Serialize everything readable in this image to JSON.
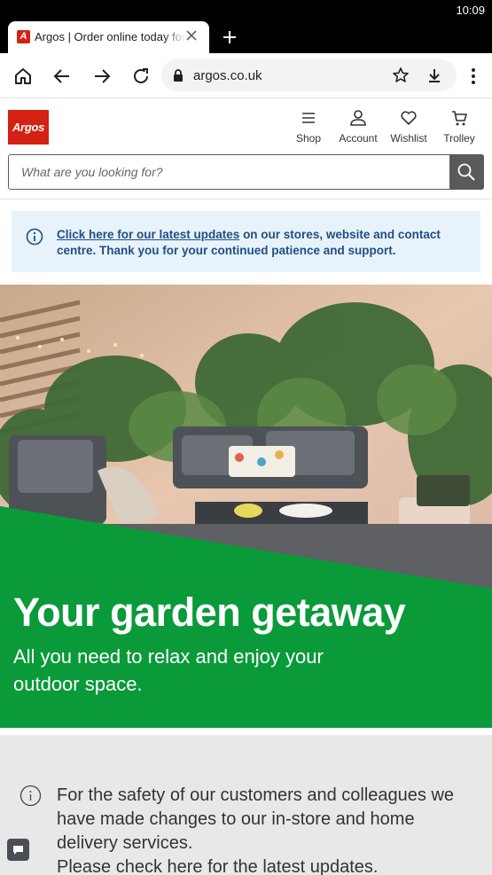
{
  "status_bar": {
    "time": "10:09"
  },
  "browser": {
    "tab": {
      "title": "Argos | Order online today for fast home delivery",
      "favicon": "argos-favicon-icon"
    },
    "address": {
      "url": "argos.co.uk"
    }
  },
  "site": {
    "logo_text": "Argos",
    "nav": [
      {
        "label": "Shop",
        "icon": "menu-icon"
      },
      {
        "label": "Account",
        "icon": "user-icon"
      },
      {
        "label": "Wishlist",
        "icon": "heart-icon"
      },
      {
        "label": "Trolley",
        "icon": "trolley-icon"
      }
    ],
    "search": {
      "placeholder": "What are you looking for?"
    }
  },
  "notice": {
    "link_text": "Click here for our latest updates",
    "rest_text": " on our stores, website and contact centre. Thank you for your continued patience and support."
  },
  "hero": {
    "title": "Your garden getaway",
    "subtitle": "All you need to relax and enjoy your outdoor space."
  },
  "safety": {
    "text_line1": "For the safety of our customers and colleagues we have made changes to our in-store and home delivery services.",
    "text_line2": "Please check here for the latest updates."
  },
  "colors": {
    "brand_red": "#d42114",
    "hero_green": "#0a9a3a",
    "notice_blue": "#1f4f86"
  }
}
